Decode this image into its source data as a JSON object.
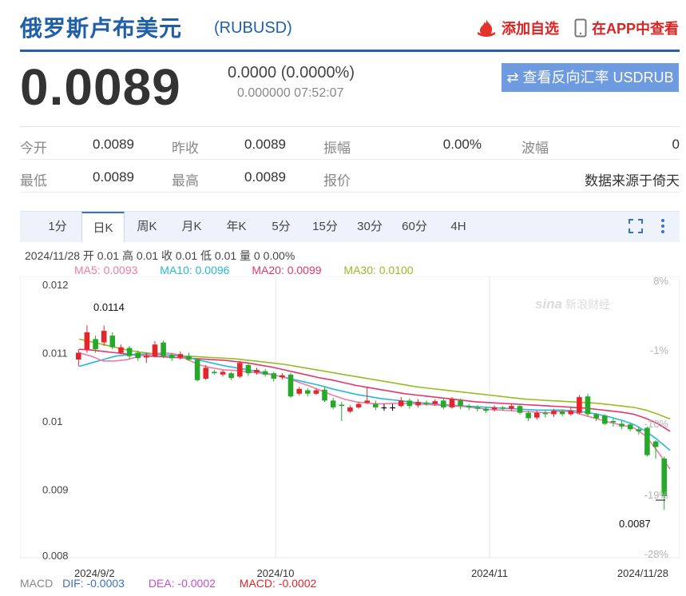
{
  "header": {
    "title": "俄罗斯卢布美元",
    "code": "(RUBUSD)",
    "add_favorite": "添加自选",
    "app_view": "在APP中查看"
  },
  "quote": {
    "price": "0.0089",
    "change": "0.0000 (0.0000%)",
    "time": "0.000000 07:52:07",
    "reverse_button": "查看反向汇率 USDRUB"
  },
  "stats": {
    "row1": [
      {
        "label": "今开",
        "value": "0.0089"
      },
      {
        "label": "昨收",
        "value": "0.0089"
      },
      {
        "label": "振幅",
        "value": "0.00%"
      },
      {
        "label": "波幅",
        "value": "0"
      }
    ],
    "row2": [
      {
        "label": "最低",
        "value": "0.0089"
      },
      {
        "label": "最高",
        "value": "0.0089"
      },
      {
        "label": "报价",
        "value": "数据来源于倚天"
      }
    ]
  },
  "tabs": [
    "1分",
    "日K",
    "周K",
    "月K",
    "年K",
    "5分",
    "15分",
    "30分",
    "60分",
    "4H"
  ],
  "active_tab": "日K",
  "info_line": "2024/11/28 开 0.01 高 0.01 收 0.01 低 0.01 量 0 0.00%",
  "ma": {
    "ma5": "MA5: 0.0093",
    "ma10": "MA10: 0.0096",
    "ma20": "MA20: 0.0099",
    "ma30": "MA30: 0.0100"
  },
  "macd": {
    "label": "MACD",
    "dif": "DIF: -0.0003",
    "dea": "DEA: -0.0002",
    "macd": "MACD: -0.0002"
  },
  "colors": {
    "up": "#e5252a",
    "down": "#26a92a",
    "ma5": "#ef7ba6",
    "ma10": "#27b7d8",
    "ma20": "#e2376a",
    "ma30": "#99bb22",
    "brand": "#1e5fa8"
  },
  "chart_data": {
    "type": "candlestick",
    "y_ticks": [
      "0.012",
      "0.011",
      "0.01",
      "0.009",
      "0.008"
    ],
    "y_range": [
      0.008,
      0.012
    ],
    "pct_ticks": [
      "8%",
      "-1%",
      "-10%",
      "-19%",
      "-28%"
    ],
    "x_labels": [
      "2024/9/2",
      "2024/10",
      "2024/11",
      "2024/11/28"
    ],
    "max_label": "0.0114",
    "min_label": "0.0087",
    "candles": [
      {
        "o": 0.0109,
        "c": 0.011,
        "h": 0.01105,
        "l": 0.0108
      },
      {
        "o": 0.01105,
        "c": 0.0113,
        "h": 0.0114,
        "l": 0.011
      },
      {
        "o": 0.0112,
        "c": 0.01105,
        "h": 0.01125,
        "l": 0.011
      },
      {
        "o": 0.01115,
        "c": 0.01132,
        "h": 0.0114,
        "l": 0.0111
      },
      {
        "o": 0.01125,
        "c": 0.01108,
        "h": 0.0113,
        "l": 0.01105
      },
      {
        "o": 0.011,
        "c": 0.01108,
        "h": 0.01112,
        "l": 0.01098
      },
      {
        "o": 0.01107,
        "c": 0.01095,
        "h": 0.0111,
        "l": 0.0109
      },
      {
        "o": 0.011,
        "c": 0.01092,
        "h": 0.01103,
        "l": 0.01088
      },
      {
        "o": 0.01093,
        "c": 0.01095,
        "h": 0.011,
        "l": 0.01085
      },
      {
        "o": 0.01095,
        "c": 0.01112,
        "h": 0.01117,
        "l": 0.01093
      },
      {
        "o": 0.01115,
        "c": 0.01095,
        "h": 0.01118,
        "l": 0.01092
      },
      {
        "o": 0.01097,
        "c": 0.01092,
        "h": 0.011,
        "l": 0.01088
      },
      {
        "o": 0.01093,
        "c": 0.01098,
        "h": 0.01102,
        "l": 0.0109
      },
      {
        "o": 0.01095,
        "c": 0.0109,
        "h": 0.011,
        "l": 0.01088
      },
      {
        "o": 0.0109,
        "c": 0.0106,
        "h": 0.01092,
        "l": 0.01058
      },
      {
        "o": 0.01062,
        "c": 0.01078,
        "h": 0.01082,
        "l": 0.0106
      },
      {
        "o": 0.01072,
        "c": 0.0107,
        "h": 0.01075,
        "l": 0.01068
      },
      {
        "o": 0.01068,
        "c": 0.01072,
        "h": 0.01075,
        "l": 0.01065
      },
      {
        "o": 0.0107,
        "c": 0.01063,
        "h": 0.01072,
        "l": 0.0106
      },
      {
        "o": 0.01065,
        "c": 0.01085,
        "h": 0.01088,
        "l": 0.01063
      },
      {
        "o": 0.01082,
        "c": 0.0107,
        "h": 0.01085,
        "l": 0.01066
      },
      {
        "o": 0.01071,
        "c": 0.01075,
        "h": 0.01078,
        "l": 0.01068
      },
      {
        "o": 0.01073,
        "c": 0.01068,
        "h": 0.01076,
        "l": 0.01065
      },
      {
        "o": 0.0107,
        "c": 0.01062,
        "h": 0.01072,
        "l": 0.01058
      },
      {
        "o": 0.01064,
        "c": 0.01067,
        "h": 0.0107,
        "l": 0.01061
      },
      {
        "o": 0.01068,
        "c": 0.01036,
        "h": 0.0107,
        "l": 0.01034
      },
      {
        "o": 0.0104,
        "c": 0.01047,
        "h": 0.0105,
        "l": 0.01038
      },
      {
        "o": 0.01045,
        "c": 0.0104,
        "h": 0.01048,
        "l": 0.01036
      },
      {
        "o": 0.0104,
        "c": 0.01045,
        "h": 0.01048,
        "l": 0.01038
      },
      {
        "o": 0.01046,
        "c": 0.0103,
        "h": 0.0105,
        "l": 0.01028
      },
      {
        "o": 0.0103,
        "c": 0.0102,
        "h": 0.01034,
        "l": 0.01017
      },
      {
        "o": 0.01024,
        "c": 0.01022,
        "h": 0.01028,
        "l": 0.01
      },
      {
        "o": 0.01014,
        "c": 0.0102,
        "h": 0.01023,
        "l": 0.01012
      },
      {
        "o": 0.0102,
        "c": 0.01025,
        "h": 0.01028,
        "l": 0.01018
      },
      {
        "o": 0.01027,
        "c": 0.0103,
        "h": 0.0105,
        "l": 0.01025
      },
      {
        "o": 0.01025,
        "c": 0.0102,
        "h": 0.0103,
        "l": 0.01016
      },
      {
        "o": 0.0102,
        "c": 0.0102,
        "h": 0.01025,
        "l": 0.01015
      },
      {
        "o": 0.0102,
        "c": 0.0102,
        "h": 0.01025,
        "l": 0.01015
      },
      {
        "o": 0.01022,
        "c": 0.0103,
        "h": 0.01035,
        "l": 0.0102
      },
      {
        "o": 0.0103,
        "c": 0.01022,
        "h": 0.01033,
        "l": 0.01018
      },
      {
        "o": 0.01023,
        "c": 0.01028,
        "h": 0.01032,
        "l": 0.0102
      },
      {
        "o": 0.01027,
        "c": 0.01025,
        "h": 0.0103,
        "l": 0.01022
      },
      {
        "o": 0.01025,
        "c": 0.01029,
        "h": 0.01032,
        "l": 0.01022
      },
      {
        "o": 0.0103,
        "c": 0.0102,
        "h": 0.01034,
        "l": 0.01017
      },
      {
        "o": 0.0102,
        "c": 0.01032,
        "h": 0.01035,
        "l": 0.01018
      },
      {
        "o": 0.0103,
        "c": 0.01022,
        "h": 0.01033,
        "l": 0.01017
      },
      {
        "o": 0.01022,
        "c": 0.0102,
        "h": 0.01025,
        "l": 0.01016
      },
      {
        "o": 0.0102,
        "c": 0.01018,
        "h": 0.01023,
        "l": 0.01014
      },
      {
        "o": 0.01018,
        "c": 0.01015,
        "h": 0.01021,
        "l": 0.01012
      },
      {
        "o": 0.01017,
        "c": 0.0102,
        "h": 0.01023,
        "l": 0.01014
      },
      {
        "o": 0.0102,
        "c": 0.01018,
        "h": 0.01022,
        "l": 0.01015
      },
      {
        "o": 0.01018,
        "c": 0.01022,
        "h": 0.01025,
        "l": 0.01015
      },
      {
        "o": 0.01022,
        "c": 0.01012,
        "h": 0.01025,
        "l": 0.0101
      },
      {
        "o": 0.01012,
        "c": 0.01004,
        "h": 0.01015,
        "l": 0.01
      },
      {
        "o": 0.01005,
        "c": 0.01012,
        "h": 0.01015,
        "l": 0.01002
      },
      {
        "o": 0.01012,
        "c": 0.0101,
        "h": 0.01015,
        "l": 0.01005
      },
      {
        "o": 0.0101,
        "c": 0.01015,
        "h": 0.01018,
        "l": 0.01006
      },
      {
        "o": 0.01014,
        "c": 0.0101,
        "h": 0.01017,
        "l": 0.01007
      },
      {
        "o": 0.0101,
        "c": 0.01015,
        "h": 0.0102,
        "l": 0.01008
      },
      {
        "o": 0.01012,
        "c": 0.01035,
        "h": 0.01038,
        "l": 0.0101
      },
      {
        "o": 0.01036,
        "c": 0.0101,
        "h": 0.0104,
        "l": 0.01006
      },
      {
        "o": 0.0101,
        "c": 0.01004,
        "h": 0.01012,
        "l": 0.01
      },
      {
        "o": 0.01008,
        "c": 0.00996,
        "h": 0.0101,
        "l": 0.00994
      },
      {
        "o": 0.01,
        "c": 0.00998,
        "h": 0.01004,
        "l": 0.00992
      },
      {
        "o": 0.00996,
        "c": 0.00992,
        "h": 0.01,
        "l": 0.00988
      },
      {
        "o": 0.00995,
        "c": 0.00988,
        "h": 0.00998,
        "l": 0.00985
      },
      {
        "o": 0.00988,
        "c": 0.00985,
        "h": 0.00992,
        "l": 0.0098
      },
      {
        "o": 0.0099,
        "c": 0.0095,
        "h": 0.00992,
        "l": 0.00948
      },
      {
        "o": 0.0097,
        "c": 0.00962,
        "h": 0.00972,
        "l": 0.00945
      },
      {
        "o": 0.00945,
        "c": 0.0089,
        "h": 0.00948,
        "l": 0.0087
      }
    ],
    "ma_series": {
      "ma5": [
        0.011,
        0.01095,
        0.01088,
        0.01088,
        0.0109,
        0.01095,
        0.01098,
        0.011,
        0.01098,
        0.0109,
        0.01082,
        0.01078,
        0.01075,
        0.01074,
        0.01072,
        0.0107,
        0.01068,
        0.01064,
        0.01058,
        0.01052,
        0.01045,
        0.01038,
        0.01032,
        0.01028,
        0.01026,
        0.01025,
        0.01026,
        0.01026,
        0.01025,
        0.01024,
        0.01023,
        0.01022,
        0.01021,
        0.01019,
        0.01017,
        0.01016,
        0.01015,
        0.01014,
        0.01013,
        0.01012,
        0.01015,
        0.01013,
        0.01008,
        0.01003,
        0.00998,
        0.00994,
        0.0099,
        0.00978,
        0.00955,
        0.0093
      ],
      "ma10": [
        0.0108,
        0.01085,
        0.0109,
        0.01095,
        0.01097,
        0.01098,
        0.01098,
        0.01097,
        0.01096,
        0.01093,
        0.01089,
        0.01085,
        0.01081,
        0.01078,
        0.01075,
        0.01072,
        0.01068,
        0.01064,
        0.0106,
        0.01056,
        0.01052,
        0.01047,
        0.01043,
        0.01039,
        0.01036,
        0.01033,
        0.01031,
        0.01029,
        0.01027,
        0.01026,
        0.01024,
        0.01023,
        0.01022,
        0.01021,
        0.0102,
        0.01019,
        0.01018,
        0.01017,
        0.01016,
        0.01016,
        0.01016,
        0.01015,
        0.01013,
        0.0101,
        0.01006,
        0.01001,
        0.00995,
        0.00985,
        0.00972,
        0.00957
      ],
      "ma20": [
        0.01105,
        0.01104,
        0.01102,
        0.011,
        0.01098,
        0.01096,
        0.01095,
        0.01094,
        0.01093,
        0.01092,
        0.01091,
        0.0109,
        0.01089,
        0.01087,
        0.01085,
        0.01082,
        0.01079,
        0.01075,
        0.01071,
        0.01067,
        0.01063,
        0.0106,
        0.01056,
        0.01052,
        0.01049,
        0.01046,
        0.01043,
        0.0104,
        0.01038,
        0.01036,
        0.01034,
        0.01032,
        0.0103,
        0.01028,
        0.01027,
        0.01026,
        0.01025,
        0.01024,
        0.01023,
        0.01022,
        0.01021,
        0.0102,
        0.01019,
        0.01017,
        0.01015,
        0.01013,
        0.0101,
        0.01004,
        0.00996,
        0.00985
      ],
      "ma30": [
        0.0112,
        0.01116,
        0.01112,
        0.01108,
        0.01104,
        0.01101,
        0.01099,
        0.01097,
        0.01096,
        0.01095,
        0.01094,
        0.01093,
        0.01092,
        0.01091,
        0.01089,
        0.01087,
        0.01085,
        0.01083,
        0.0108,
        0.01077,
        0.01074,
        0.01071,
        0.01068,
        0.01065,
        0.01062,
        0.01059,
        0.01056,
        0.01053,
        0.0105,
        0.01048,
        0.01046,
        0.01044,
        0.01042,
        0.0104,
        0.01038,
        0.01036,
        0.01034,
        0.01032,
        0.01031,
        0.0103,
        0.01029,
        0.01028,
        0.01027,
        0.01026,
        0.01024,
        0.01022,
        0.0102,
        0.01016,
        0.0101,
        0.01003
      ]
    }
  }
}
